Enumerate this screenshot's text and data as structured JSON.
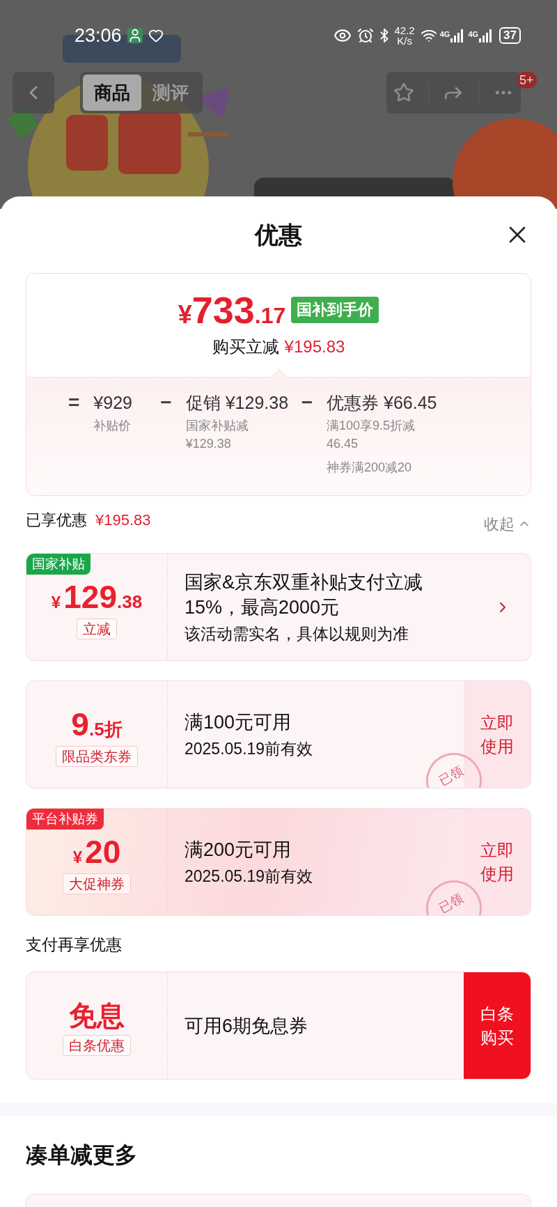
{
  "status_bar": {
    "time": "23:06",
    "speed_value": "42.2",
    "speed_unit": "K/s",
    "networks": [
      "4G",
      "4G"
    ],
    "battery": "37"
  },
  "nav": {
    "tabs": [
      {
        "label": "商品",
        "selected": true
      },
      {
        "label": "测评",
        "selected": false
      }
    ],
    "badge": "5+"
  },
  "sheet": {
    "title": "优惠",
    "summary": {
      "symbol": "¥",
      "price_int": "733",
      "price_dec": ".17",
      "tag": "国补到手价",
      "saving_label": "购买立减",
      "saving_value": "¥195.83",
      "breakdown": [
        {
          "op": "=",
          "heading": "¥929",
          "notes": [
            "补贴价"
          ]
        },
        {
          "op": "−",
          "heading": "促销 ¥129.38",
          "notes": [
            "国家补贴减 ¥129.38"
          ]
        },
        {
          "op": "−",
          "heading": "优惠券 ¥66.45",
          "notes": [
            "满100享9.5折减 46.45",
            "神券满200减20"
          ]
        }
      ]
    },
    "applied": {
      "label": "已享优惠",
      "value": "¥195.83",
      "toggle": "收起",
      "expanded": true
    },
    "coupons": [
      {
        "kind": "subsidy",
        "tag": {
          "text": "国家补贴",
          "color": "#1aa64a"
        },
        "amount": {
          "symbol": "¥",
          "main": "129",
          "decimal": ".38"
        },
        "sublabel": "立减",
        "title": "国家&京东双重补贴支付立减15%，最高2000元",
        "detail": "该活动需实名，具体以规则为准"
      },
      {
        "kind": "coupon",
        "amount": {
          "main": "9",
          "decimal": ".5折"
        },
        "sublabel": "限品类东券",
        "title": "满100元可用",
        "detail": "2025.05.19前有效",
        "action": "立即使用",
        "stamp": "已领"
      },
      {
        "kind": "coupon",
        "gradient": true,
        "tag": {
          "text": "平台补贴券",
          "color": "#ef2c3c"
        },
        "amount": {
          "symbol": "¥",
          "main": "20"
        },
        "sublabel": "大促神券",
        "title": "满200元可用",
        "detail": "2025.05.19前有效",
        "action": "立即使用",
        "stamp": "已领"
      }
    ],
    "pay_heading": "支付再享优惠",
    "pay_offers": [
      {
        "kind": "pay",
        "amount": {
          "main": "免息"
        },
        "sublabel": "白条优惠",
        "title": "可用6期免息券",
        "action": "白条购买"
      }
    ],
    "more_heading": "凑单减更多"
  }
}
